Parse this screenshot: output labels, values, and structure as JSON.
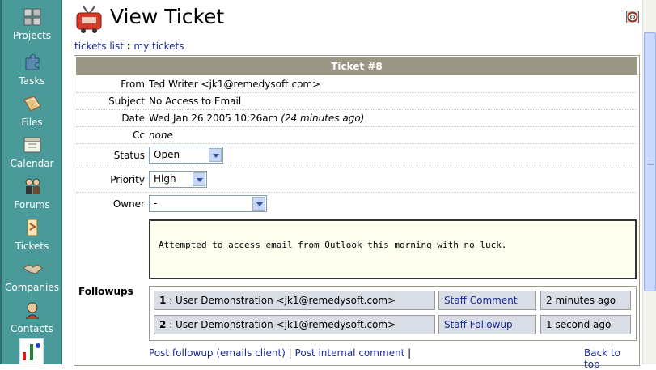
{
  "sidebar": {
    "items": [
      {
        "label": "Projects",
        "icon": "projects-icon"
      },
      {
        "label": "Tasks",
        "icon": "puzzle-icon"
      },
      {
        "label": "Files",
        "icon": "files-icon"
      },
      {
        "label": "Calendar",
        "icon": "calendar-icon"
      },
      {
        "label": "Forums",
        "icon": "forums-icon"
      },
      {
        "label": "Tickets",
        "icon": "tickets-icon"
      },
      {
        "label": "Companies",
        "icon": "handshake-icon"
      },
      {
        "label": "Contacts",
        "icon": "contacts-icon"
      }
    ]
  },
  "header": {
    "title": "View Ticket",
    "breadcrumb": {
      "link1": "tickets list",
      "separator": ":",
      "link2": "my tickets"
    }
  },
  "ticket": {
    "header": "Ticket #8",
    "fields": {
      "from_label": "From",
      "from_value": "Ted Writer <jk1@remedysoft.com>",
      "subject_label": "Subject",
      "subject_value": "No Access to Email",
      "date_label": "Date",
      "date_value": "Wed Jan 26 2005 10:26am",
      "date_relative": "(24 minutes ago)",
      "cc_label": "Cc",
      "cc_value": "none",
      "status_label": "Status",
      "status_value": "Open",
      "priority_label": "Priority",
      "priority_value": "High",
      "owner_label": "Owner",
      "owner_value": "-"
    },
    "description": "Attempted to access email from Outlook this morning with no luck."
  },
  "followups": {
    "label": "Followups",
    "rows": [
      {
        "num": "1",
        "author": ": User Demonstration <jk1@remedysoft.com>",
        "type": "Staff Comment",
        "time": "2 minutes ago"
      },
      {
        "num": "2",
        "author": ": User Demonstration <jk1@remedysoft.com>",
        "type": "Staff Followup",
        "time": "1 second ago"
      }
    ]
  },
  "footer": {
    "post_followup": "Post followup (emails client)",
    "sep1": "|",
    "post_internal": "Post internal comment",
    "sep2": "|",
    "back_to_top": "Back to top"
  },
  "colors": {
    "sidebar": "#4a9a9a",
    "ticket_header": "#9a9584",
    "link": "#1a2a9a",
    "description_bg": "#fffff0",
    "followup_cell": "#d9dee6"
  }
}
